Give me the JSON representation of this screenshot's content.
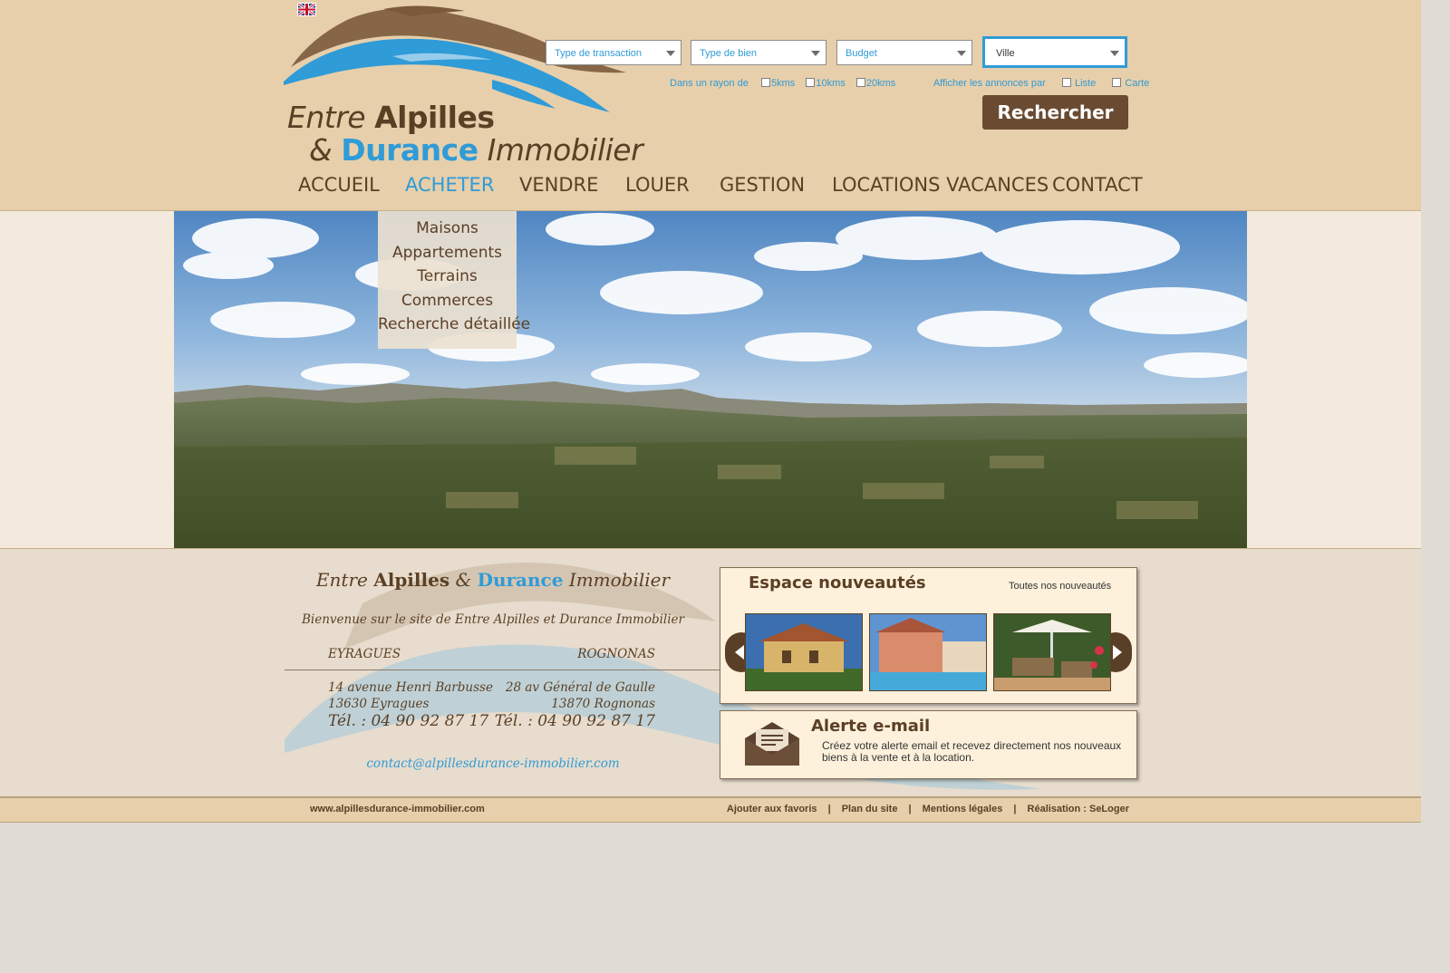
{
  "header": {
    "language_flag": "uk-flag-icon",
    "logo": {
      "line1_italic": "Entre",
      "line1_bold": "Alpilles",
      "line2_amp": "&",
      "line2_bold": "Durance",
      "line2_italic": "Immobilier"
    },
    "search": {
      "transaction": "Type de transaction",
      "property_type": "Type de bien",
      "budget": "Budget",
      "city": "Ville",
      "radius_label": "Dans un rayon de",
      "radius_options": [
        "5kms",
        "10kms",
        "20kms"
      ],
      "display_label": "Afficher les annonces par",
      "display_options": [
        "Liste",
        "Carte"
      ],
      "button": "Rechercher"
    },
    "nav": [
      {
        "label": "ACCUEIL"
      },
      {
        "label": "ACHETER",
        "active": true
      },
      {
        "label": "VENDRE"
      },
      {
        "label": "LOUER"
      },
      {
        "label": "GESTION"
      },
      {
        "label": "LOCATIONS VACANCES"
      },
      {
        "label": "CONTACT"
      }
    ],
    "submenu": [
      "Maisons",
      "Appartements",
      "Terrains",
      "Commerces",
      "Recherche détaillée"
    ]
  },
  "agency": {
    "title_italic1": "Entre",
    "title_bold1": "Alpilles",
    "title_amp": "&",
    "title_bold2": "Durance",
    "title_italic2": "Immobilier",
    "welcome": "Bienvenue sur le site de Entre Alpilles et Durance Immobilier",
    "offices": [
      {
        "city": "EYRAGUES",
        "street": "14 avenue Henri Barbusse",
        "postal": "13630 Eyragues",
        "tel": "Tél. : 04 90 92 87 17"
      },
      {
        "city": "ROGNONAS",
        "street": "28 av Général de Gaulle",
        "postal": "13870 Rognonas",
        "tel": "Tél. : 04 90 92 87 17"
      }
    ],
    "email": "contact@alpillesdurance-immobilier.com"
  },
  "news": {
    "title": "Espace nouveautés",
    "all_link": "Toutes nos nouveautés"
  },
  "alert": {
    "title": "Alerte e-mail",
    "text": "Créez votre alerte email et recevez directement nos nouveaux biens à la vente et à la location."
  },
  "footer": {
    "site": "www.alpillesdurance-immobilier.com",
    "links": [
      "Ajouter aux favoris",
      "Plan du site",
      "Mentions légales",
      "Réalisation : SeLoger"
    ]
  },
  "colors": {
    "brand_brown": "#5b3f25",
    "brand_blue": "#2f9bd7",
    "header_bg": "#e7cfab"
  }
}
